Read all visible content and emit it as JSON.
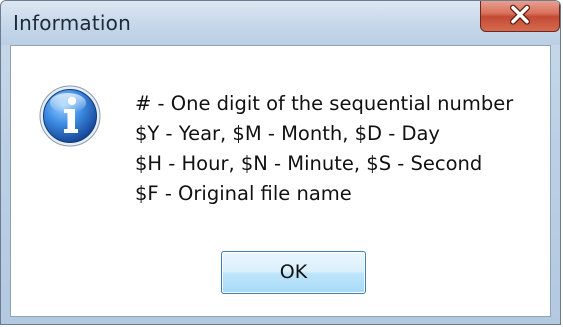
{
  "window": {
    "title": "Information",
    "close_icon": "close-icon"
  },
  "dialog": {
    "icon": "info-icon",
    "message_lines": [
      "#  - One digit of the sequential number",
      "$Y - Year, $M - Month, $D - Day",
      "$H - Hour, $N - Minute, $S - Second",
      "$F - Original file name"
    ],
    "ok_label": "OK"
  },
  "colors": {
    "title_bar": "#c4d6ea",
    "close_button": "#c44a33",
    "info_icon_blue": "#1f5fb8",
    "ok_button_border": "#3c7fb1"
  }
}
